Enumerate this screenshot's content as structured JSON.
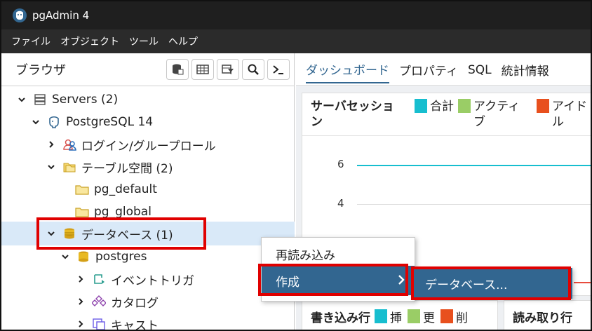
{
  "window": {
    "title": "pgAdmin 4"
  },
  "menu": [
    "ファイル",
    "オブジェクト",
    "ツール",
    "ヘルプ"
  ],
  "browser": {
    "title": "ブラウザ",
    "tree": [
      {
        "label": "Servers (2)",
        "icon": "servers-icon"
      },
      {
        "label": "PostgreSQL 14",
        "icon": "elephant-icon"
      },
      {
        "label": "ログイン/グループロール",
        "icon": "roles-icon"
      },
      {
        "label": "テーブル空間 (2)",
        "icon": "tablespaces-icon"
      },
      {
        "label": "pg_default",
        "icon": "folder-icon"
      },
      {
        "label": "pg_global",
        "icon": "folder-icon"
      },
      {
        "label": "データベース (1)",
        "icon": "databases-icon"
      },
      {
        "label": "postgres",
        "icon": "database-icon"
      },
      {
        "label": "イベントトリガ",
        "icon": "event-trigger-icon"
      },
      {
        "label": "カタログ",
        "icon": "catalog-icon"
      },
      {
        "label": "キャスト",
        "icon": "cast-icon"
      }
    ]
  },
  "tabs": [
    "ダッシュボード",
    "プロパティ",
    "SQL",
    "統計情報"
  ],
  "dashboard": {
    "sessions_title": "サーバセッション",
    "legend": [
      {
        "label": "合計",
        "color": "#17becf"
      },
      {
        "label": "アクティブ",
        "color": "#9acd66"
      },
      {
        "label": "アイドル",
        "color": "#e8501e"
      }
    ],
    "yticks": [
      "6",
      "4"
    ],
    "writes_title": "書き込み行",
    "writes_legend": [
      "挿",
      "更",
      "削"
    ],
    "reads_title": "読み取り行"
  },
  "context_menu": {
    "items": [
      "再読み込み",
      "作成"
    ],
    "submenu": [
      "データベース..."
    ]
  }
}
